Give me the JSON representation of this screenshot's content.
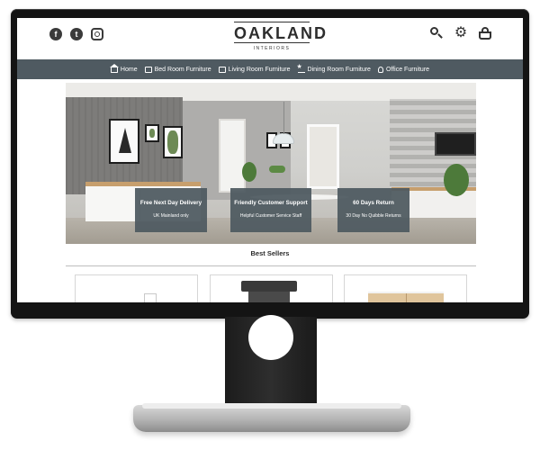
{
  "site": {
    "brand": "OAKLAND",
    "brand_sub": "INTERIORS"
  },
  "header": {
    "social_icons": [
      "facebook-icon",
      "twitter-icon",
      "instagram-icon"
    ],
    "tool_icons": [
      "search-icon",
      "gear-icon",
      "basket-icon"
    ]
  },
  "nav": {
    "items": [
      {
        "label": "Home",
        "icon": "home-icon"
      },
      {
        "label": "Bed Room Furniture",
        "icon": "bed-icon"
      },
      {
        "label": "Living Room Furniture",
        "icon": "sofa-icon"
      },
      {
        "label": "Dining Room Furniture",
        "icon": "dining-icon"
      },
      {
        "label": "Office Furniture",
        "icon": "lamp-icon"
      }
    ]
  },
  "features": [
    {
      "title": "Free Next Day Delivery",
      "subtitle": "UK Mainland only"
    },
    {
      "title": "Friendly Customer Support",
      "subtitle": "Helpful Customer Service Staff"
    },
    {
      "title": "60 Days Return",
      "subtitle": "30 Day No Quibble Returns"
    }
  ],
  "best_sellers": {
    "title": "Best Sellers"
  },
  "colors": {
    "nav_bg": "#4f5a61",
    "feature_bg": "#4f5a61",
    "monitor_bezel": "#141414",
    "text_dark": "#2b2b2b"
  }
}
